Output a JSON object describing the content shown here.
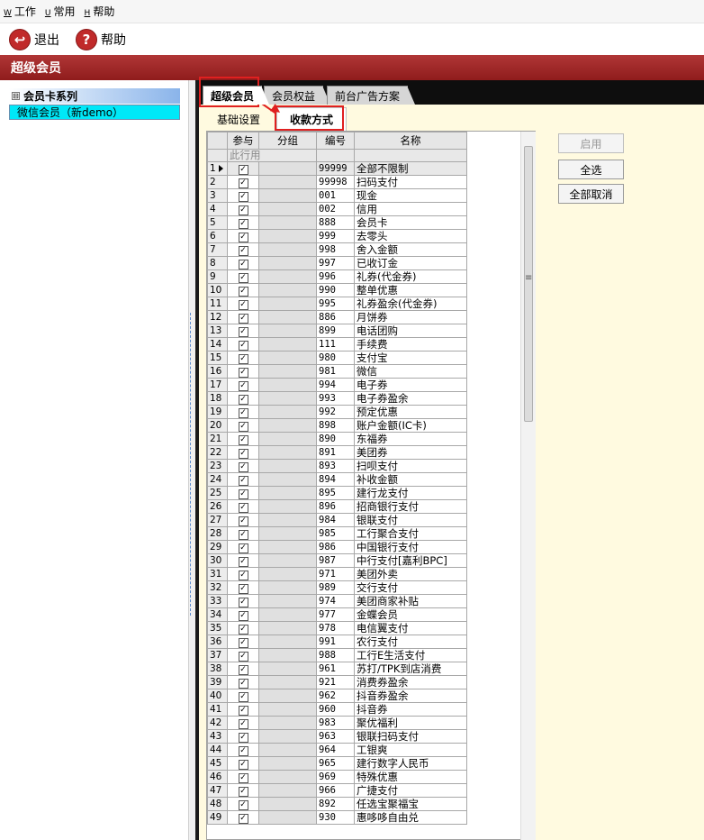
{
  "menu": {
    "items": [
      {
        "hotkey": "W",
        "label": "工作"
      },
      {
        "hotkey": "U",
        "label": "常用"
      },
      {
        "hotkey": "H",
        "label": "帮助"
      }
    ]
  },
  "toolbar": {
    "exit_label": "退出",
    "help_label": "帮助"
  },
  "window": {
    "title": "超级会员"
  },
  "tree": {
    "root_label": "会员卡系列",
    "root_toggle": "⊟",
    "child_label": "微信会员（新demo）"
  },
  "tabs": [
    "超级会员",
    "会员权益",
    "前台广告方案"
  ],
  "subtabs": [
    "基础设置",
    "收款方式"
  ],
  "grid": {
    "columns": [
      "参与",
      "分组",
      "编号",
      "名称"
    ],
    "hint_text": "此行用",
    "check_mark": "✓",
    "rows": [
      {
        "n": "1",
        "code": "99999",
        "name": "全部不限制"
      },
      {
        "n": "2",
        "code": "99998",
        "name": "扫码支付"
      },
      {
        "n": "3",
        "code": "001",
        "name": "现金"
      },
      {
        "n": "4",
        "code": "002",
        "name": "信用"
      },
      {
        "n": "5",
        "code": "888",
        "name": "会员卡"
      },
      {
        "n": "6",
        "code": "999",
        "name": "去零头"
      },
      {
        "n": "7",
        "code": "998",
        "name": "舍入金额"
      },
      {
        "n": "8",
        "code": "997",
        "name": "已收订金"
      },
      {
        "n": "9",
        "code": "996",
        "name": "礼券(代金券)"
      },
      {
        "n": "10",
        "code": "990",
        "name": "整单优惠"
      },
      {
        "n": "11",
        "code": "995",
        "name": "礼券盈余(代金券)"
      },
      {
        "n": "12",
        "code": "886",
        "name": "月饼券"
      },
      {
        "n": "13",
        "code": "899",
        "name": "电话团购"
      },
      {
        "n": "14",
        "code": "111",
        "name": "手续费"
      },
      {
        "n": "15",
        "code": "980",
        "name": "支付宝"
      },
      {
        "n": "16",
        "code": "981",
        "name": "微信"
      },
      {
        "n": "17",
        "code": "994",
        "name": "电子券"
      },
      {
        "n": "18",
        "code": "993",
        "name": "电子券盈余"
      },
      {
        "n": "19",
        "code": "992",
        "name": "预定优惠"
      },
      {
        "n": "20",
        "code": "898",
        "name": "账户金额(IC卡)"
      },
      {
        "n": "21",
        "code": "890",
        "name": "东福券"
      },
      {
        "n": "22",
        "code": "891",
        "name": "美团券"
      },
      {
        "n": "23",
        "code": "893",
        "name": "扫呗支付"
      },
      {
        "n": "24",
        "code": "894",
        "name": "补收金额"
      },
      {
        "n": "25",
        "code": "895",
        "name": "建行龙支付"
      },
      {
        "n": "26",
        "code": "896",
        "name": "招商银行支付"
      },
      {
        "n": "27",
        "code": "984",
        "name": "银联支付"
      },
      {
        "n": "28",
        "code": "985",
        "name": "工行聚合支付"
      },
      {
        "n": "29",
        "code": "986",
        "name": "中国银行支付"
      },
      {
        "n": "30",
        "code": "987",
        "name": "中行支付[嘉利BPC]"
      },
      {
        "n": "31",
        "code": "971",
        "name": "美团外卖"
      },
      {
        "n": "32",
        "code": "989",
        "name": "交行支付"
      },
      {
        "n": "33",
        "code": "974",
        "name": "美团商家补贴"
      },
      {
        "n": "34",
        "code": "977",
        "name": "金蝶会员"
      },
      {
        "n": "35",
        "code": "978",
        "name": "电信翼支付"
      },
      {
        "n": "36",
        "code": "991",
        "name": "农行支付"
      },
      {
        "n": "37",
        "code": "988",
        "name": "工行E生活支付"
      },
      {
        "n": "38",
        "code": "961",
        "name": "苏打/TPK到店消费"
      },
      {
        "n": "39",
        "code": "921",
        "name": "消费券盈余"
      },
      {
        "n": "40",
        "code": "962",
        "name": "抖音券盈余"
      },
      {
        "n": "41",
        "code": "960",
        "name": "抖音券"
      },
      {
        "n": "42",
        "code": "983",
        "name": "聚优福利"
      },
      {
        "n": "43",
        "code": "963",
        "name": "银联扫码支付"
      },
      {
        "n": "44",
        "code": "964",
        "name": "工银爽"
      },
      {
        "n": "45",
        "code": "965",
        "name": "建行数字人民币"
      },
      {
        "n": "46",
        "code": "969",
        "name": "特殊优惠"
      },
      {
        "n": "47",
        "code": "966",
        "name": "广捷支付"
      },
      {
        "n": "48",
        "code": "892",
        "name": "任选宝聚福宝"
      },
      {
        "n": "49",
        "code": "930",
        "name": "惠哆哆自由兑"
      }
    ]
  },
  "actions": {
    "enable_label": "启用",
    "select_all_label": "全选",
    "deselect_all_label": "全部取消"
  },
  "colors": {
    "titlebar": "#a02828",
    "highlight": "#e02020",
    "tree_selected": "#00e8f8",
    "content_bg": "#fffae0"
  }
}
